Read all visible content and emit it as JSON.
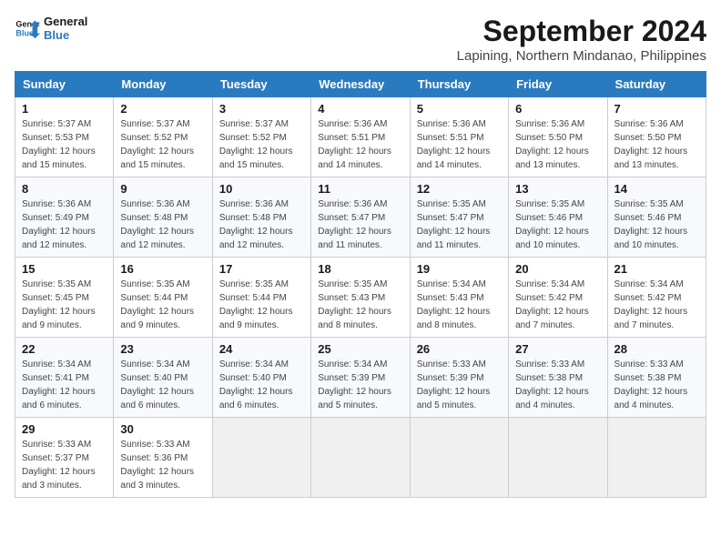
{
  "logo": {
    "line1": "General",
    "line2": "Blue"
  },
  "title": "September 2024",
  "location": "Lapining, Northern Mindanao, Philippines",
  "days_of_week": [
    "Sunday",
    "Monday",
    "Tuesday",
    "Wednesday",
    "Thursday",
    "Friday",
    "Saturday"
  ],
  "weeks": [
    [
      {
        "day": "1",
        "sunrise": "5:37 AM",
        "sunset": "5:53 PM",
        "daylight": "12 hours and 15 minutes."
      },
      {
        "day": "2",
        "sunrise": "5:37 AM",
        "sunset": "5:52 PM",
        "daylight": "12 hours and 15 minutes."
      },
      {
        "day": "3",
        "sunrise": "5:37 AM",
        "sunset": "5:52 PM",
        "daylight": "12 hours and 15 minutes."
      },
      {
        "day": "4",
        "sunrise": "5:36 AM",
        "sunset": "5:51 PM",
        "daylight": "12 hours and 14 minutes."
      },
      {
        "day": "5",
        "sunrise": "5:36 AM",
        "sunset": "5:51 PM",
        "daylight": "12 hours and 14 minutes."
      },
      {
        "day": "6",
        "sunrise": "5:36 AM",
        "sunset": "5:50 PM",
        "daylight": "12 hours and 13 minutes."
      },
      {
        "day": "7",
        "sunrise": "5:36 AM",
        "sunset": "5:50 PM",
        "daylight": "12 hours and 13 minutes."
      }
    ],
    [
      {
        "day": "8",
        "sunrise": "5:36 AM",
        "sunset": "5:49 PM",
        "daylight": "12 hours and 12 minutes."
      },
      {
        "day": "9",
        "sunrise": "5:36 AM",
        "sunset": "5:48 PM",
        "daylight": "12 hours and 12 minutes."
      },
      {
        "day": "10",
        "sunrise": "5:36 AM",
        "sunset": "5:48 PM",
        "daylight": "12 hours and 12 minutes."
      },
      {
        "day": "11",
        "sunrise": "5:36 AM",
        "sunset": "5:47 PM",
        "daylight": "12 hours and 11 minutes."
      },
      {
        "day": "12",
        "sunrise": "5:35 AM",
        "sunset": "5:47 PM",
        "daylight": "12 hours and 11 minutes."
      },
      {
        "day": "13",
        "sunrise": "5:35 AM",
        "sunset": "5:46 PM",
        "daylight": "12 hours and 10 minutes."
      },
      {
        "day": "14",
        "sunrise": "5:35 AM",
        "sunset": "5:46 PM",
        "daylight": "12 hours and 10 minutes."
      }
    ],
    [
      {
        "day": "15",
        "sunrise": "5:35 AM",
        "sunset": "5:45 PM",
        "daylight": "12 hours and 9 minutes."
      },
      {
        "day": "16",
        "sunrise": "5:35 AM",
        "sunset": "5:44 PM",
        "daylight": "12 hours and 9 minutes."
      },
      {
        "day": "17",
        "sunrise": "5:35 AM",
        "sunset": "5:44 PM",
        "daylight": "12 hours and 9 minutes."
      },
      {
        "day": "18",
        "sunrise": "5:35 AM",
        "sunset": "5:43 PM",
        "daylight": "12 hours and 8 minutes."
      },
      {
        "day": "19",
        "sunrise": "5:34 AM",
        "sunset": "5:43 PM",
        "daylight": "12 hours and 8 minutes."
      },
      {
        "day": "20",
        "sunrise": "5:34 AM",
        "sunset": "5:42 PM",
        "daylight": "12 hours and 7 minutes."
      },
      {
        "day": "21",
        "sunrise": "5:34 AM",
        "sunset": "5:42 PM",
        "daylight": "12 hours and 7 minutes."
      }
    ],
    [
      {
        "day": "22",
        "sunrise": "5:34 AM",
        "sunset": "5:41 PM",
        "daylight": "12 hours and 6 minutes."
      },
      {
        "day": "23",
        "sunrise": "5:34 AM",
        "sunset": "5:40 PM",
        "daylight": "12 hours and 6 minutes."
      },
      {
        "day": "24",
        "sunrise": "5:34 AM",
        "sunset": "5:40 PM",
        "daylight": "12 hours and 6 minutes."
      },
      {
        "day": "25",
        "sunrise": "5:34 AM",
        "sunset": "5:39 PM",
        "daylight": "12 hours and 5 minutes."
      },
      {
        "day": "26",
        "sunrise": "5:33 AM",
        "sunset": "5:39 PM",
        "daylight": "12 hours and 5 minutes."
      },
      {
        "day": "27",
        "sunrise": "5:33 AM",
        "sunset": "5:38 PM",
        "daylight": "12 hours and 4 minutes."
      },
      {
        "day": "28",
        "sunrise": "5:33 AM",
        "sunset": "5:38 PM",
        "daylight": "12 hours and 4 minutes."
      }
    ],
    [
      {
        "day": "29",
        "sunrise": "5:33 AM",
        "sunset": "5:37 PM",
        "daylight": "12 hours and 3 minutes."
      },
      {
        "day": "30",
        "sunrise": "5:33 AM",
        "sunset": "5:36 PM",
        "daylight": "12 hours and 3 minutes."
      },
      null,
      null,
      null,
      null,
      null
    ]
  ],
  "labels": {
    "sunrise": "Sunrise:",
    "sunset": "Sunset:",
    "daylight": "Daylight:"
  }
}
